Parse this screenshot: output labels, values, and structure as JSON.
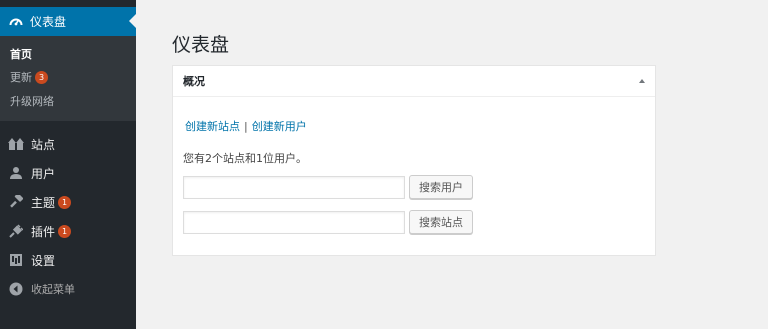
{
  "sidebar": {
    "active": {
      "label": "仪表盘",
      "icon": "dashboard-icon"
    },
    "submenu": [
      {
        "label": "首页",
        "current": true
      },
      {
        "label": "更新",
        "badge": "3"
      },
      {
        "label": "升级网络"
      }
    ],
    "items": [
      {
        "label": "站点",
        "icon": "sites-icon"
      },
      {
        "label": "用户",
        "icon": "user-icon"
      },
      {
        "label": "主题",
        "icon": "themes-icon",
        "badge": "1"
      },
      {
        "label": "插件",
        "icon": "plugins-icon",
        "badge": "1"
      },
      {
        "label": "设置",
        "icon": "settings-icon"
      },
      {
        "label": "收起菜单",
        "icon": "collapse-icon"
      }
    ]
  },
  "main": {
    "title": "仪表盘",
    "panel": {
      "title": "概况",
      "links": {
        "create_site": "创建新站点",
        "separator": "|",
        "create_user": "创建新用户"
      },
      "info": "您有2个站点和1位用户。",
      "search_users": {
        "value": "",
        "button": "搜索用户"
      },
      "search_sites": {
        "value": "",
        "button": "搜索站点"
      }
    }
  },
  "colors": {
    "sidebar_bg": "#23282d",
    "submenu_bg": "#32373c",
    "accent": "#0073aa",
    "badge": "#ca4a1f"
  }
}
